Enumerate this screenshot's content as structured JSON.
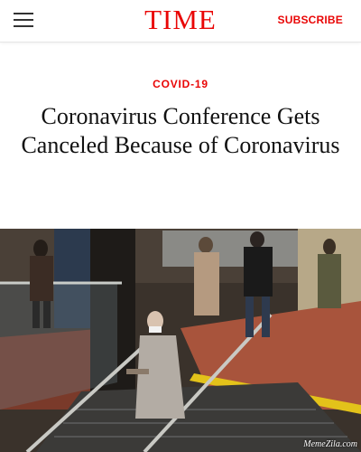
{
  "header": {
    "logo": "TIME",
    "subscribe_label": "SUBSCRIBE",
    "menu_icon": "hamburger-menu-icon",
    "brand_color": "#e90606"
  },
  "article": {
    "section": "COVID-19",
    "headline": "Coronavirus Conference Gets Canceled Because of Coronavirus"
  },
  "photo": {
    "watermark": "MemeZila.com"
  }
}
